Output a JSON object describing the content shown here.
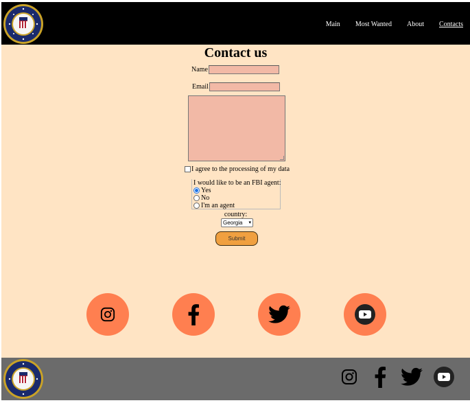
{
  "header": {
    "logo_icon": "fbi-seal-icon",
    "nav": [
      {
        "label": "Main",
        "active": false
      },
      {
        "label": "Most Wanted",
        "active": false
      },
      {
        "label": "About",
        "active": false
      },
      {
        "label": "Contacts",
        "active": true
      }
    ]
  },
  "form": {
    "title": "Contact us",
    "name_label": "Name",
    "name_value": "",
    "email_label": "Email",
    "email_value": "",
    "message_value": "",
    "agree_label": "I agree to the processing of my data",
    "agree_checked": false,
    "agent_legend": "I would like to be an FBI agent:",
    "agent_options": [
      {
        "label": "Yes",
        "selected": true
      },
      {
        "label": "No",
        "selected": false
      },
      {
        "label": "I'm an agent",
        "selected": false
      }
    ],
    "country_label": "country:",
    "country_value": "Georgia",
    "submit_label": "Submit"
  },
  "social": {
    "icons": [
      "instagram-icon",
      "facebook-icon",
      "twitter-icon",
      "youtube-icon"
    ],
    "circle_color": "#ff7f50"
  },
  "colors": {
    "header_bg": "#000000",
    "main_bg": "#ffe4c4",
    "footer_bg": "#6b6b6b",
    "input_bg": "#f2b9a6",
    "submit_bg": "#f0a040"
  }
}
